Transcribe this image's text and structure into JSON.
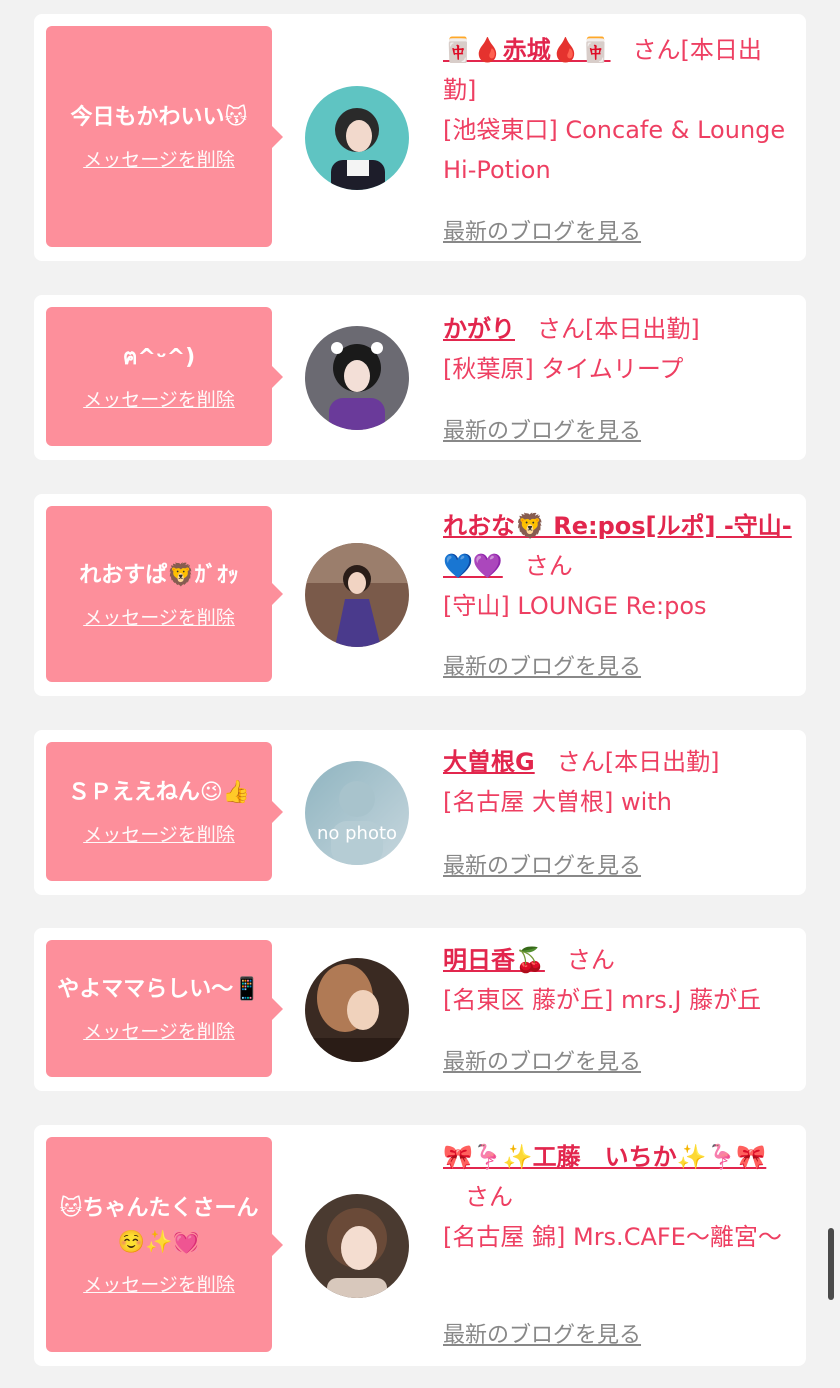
{
  "delete_label": "メッセージを削除",
  "san_label": "さん",
  "blog_label": "最新のブログを見る",
  "colors": {
    "bubble": "#fd8f9b",
    "accent": "#e2264d",
    "text": "#ee3f62",
    "link_gray": "#888888"
  },
  "items": [
    {
      "message": "今日もかわいい😽",
      "name": "🀄🩸赤城🩸🀄",
      "suffix": "[本日出勤]",
      "store": "[池袋東口] Concafe & Lounge Hi-Potion",
      "avatar_icon": "avatar-photo"
    },
    {
      "message": "ฅ^ᵕ^)",
      "name": "かがり",
      "suffix": "[本日出勤]",
      "store": "[秋葉原] タイムリープ",
      "avatar_icon": "avatar-photo"
    },
    {
      "message": "れおすぱ🦁ｶﾞｵｯ",
      "name": "れおな🦁 Re:pos[ルポ] -守山-💙💜",
      "suffix": "",
      "store": "[守山] LOUNGE Re:pos",
      "avatar_icon": "avatar-photo"
    },
    {
      "message": "ＳＰええねん😉👍",
      "name": "大曽根G",
      "suffix": "[本日出勤]",
      "store": "[名古屋 大曽根] with",
      "avatar_icon": "no-photo-placeholder",
      "avatar_text": "no photo"
    },
    {
      "message": "やよママらしい〜📱",
      "name": "明日香🍒",
      "suffix": "",
      "store": "[名東区 藤が丘] mrs.J 藤が丘",
      "avatar_icon": "avatar-photo"
    },
    {
      "message": "🐱ちゃんたくさーん☺️✨💓",
      "name": "🎀🦩✨工藤　いちか✨🦩🎀",
      "suffix": "",
      "store": "[名古屋 錦] Mrs.CAFE〜離宮〜",
      "avatar_icon": "avatar-photo"
    }
  ]
}
